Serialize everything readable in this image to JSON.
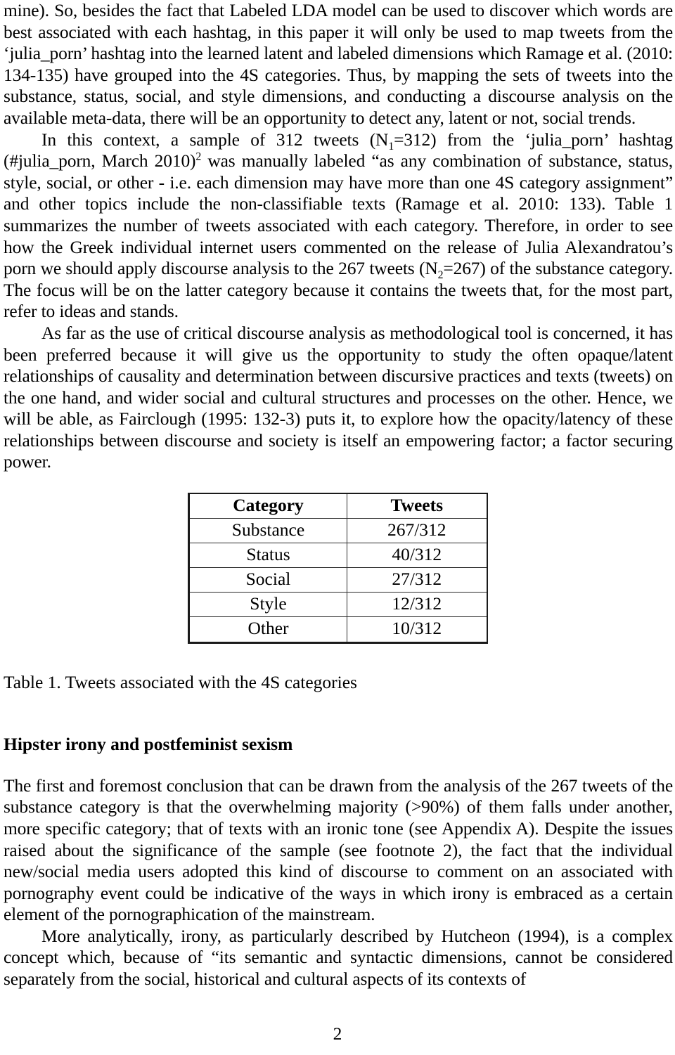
{
  "document": {
    "page_number": "2",
    "paragraphs": [
      {
        "id": "p1",
        "indent": false,
        "text": "mine). So, besides the fact that Labeled LDA model can be used to discover which words are best associated with each hashtag, in this paper it will only be used to map tweets from the ‘julia_porn’ hashtag into the learned latent and labeled dimensions which Ramage et al. (2010: 134-135) have grouped into the 4S categories. Thus, by mapping the sets of tweets into the substance, status, social, and style dimensions, and conducting a discourse analysis on the available meta-data, there will be an opportunity to detect any, latent or not, social trends."
      },
      {
        "id": "p2",
        "indent": true,
        "segments": [
          {
            "type": "text",
            "value": "In this context, a sample of 312 tweets (N"
          },
          {
            "type": "sub",
            "value": "1"
          },
          {
            "type": "text",
            "value": "=312) from the ‘julia_porn’ hashtag (#julia_porn, March 2010)"
          },
          {
            "type": "sup",
            "value": "2"
          },
          {
            "type": "text",
            "value": " was manually labeled “as any combination of substance, status, style, social, or other - i.e. each dimension may have more than one 4S category assignment” and other topics include the non-classifiable texts (Ramage et al. 2010: 133). Table 1 summarizes the number of tweets associated with each category. Therefore, in order to see how the Greek individual internet users commented on the release of Julia Alexandratou’s porn we should apply discourse analysis to the 267 tweets (N"
          },
          {
            "type": "sub",
            "value": "2"
          },
          {
            "type": "text",
            "value": "=267) of the substance category. The focus will be on the latter category because it contains the tweets that, for the most part, refer to ideas and stands."
          }
        ]
      },
      {
        "id": "p3",
        "indent": true,
        "text": "As far as the use of critical discourse analysis as methodological tool is concerned, it has been preferred because it will give us the opportunity to study the often opaque/latent relationships of causality and determination between discursive practices and texts (tweets) on the one hand, and wider social and cultural structures and processes on the other. Hence, we will be able, as Fairclough (1995: 132-3) puts it, to explore how the opacity/latency of these relationships between discourse and society is itself an empowering factor; a factor securing power."
      }
    ],
    "table": {
      "headers": [
        "Category",
        "Tweets"
      ],
      "rows": [
        [
          "Substance",
          "267/312"
        ],
        [
          "Status",
          "40/312"
        ],
        [
          "Social",
          "27/312"
        ],
        [
          "Style",
          "12/312"
        ],
        [
          "Other",
          "10/312"
        ]
      ],
      "caption": "Table 1. Tweets associated with the 4S categories"
    },
    "section": {
      "heading": "Hipster irony and postfeminist sexism",
      "paragraphs": [
        {
          "id": "s1",
          "indent": false,
          "text": "The first and foremost conclusion that can be drawn from the analysis of the 267 tweets of the substance category is that the overwhelming majority (>90%) of them falls under another, more specific category; that of texts with an ironic tone (see Appendix A). Despite the issues raised about the significance of the sample (see footnote 2), the fact that the individual new/social media users adopted this kind of discourse to comment on an associated with pornography event could be indicative of the ways in which irony is embraced as a certain element of the pornographication of the mainstream."
        },
        {
          "id": "s2",
          "indent": true,
          "text": "More analytically, irony, as particularly described by Hutcheon (1994), is a complex concept which, because of “its semantic and syntactic dimensions, cannot be considered separately from the social, historical and cultural aspects of its contexts of"
        }
      ]
    }
  }
}
